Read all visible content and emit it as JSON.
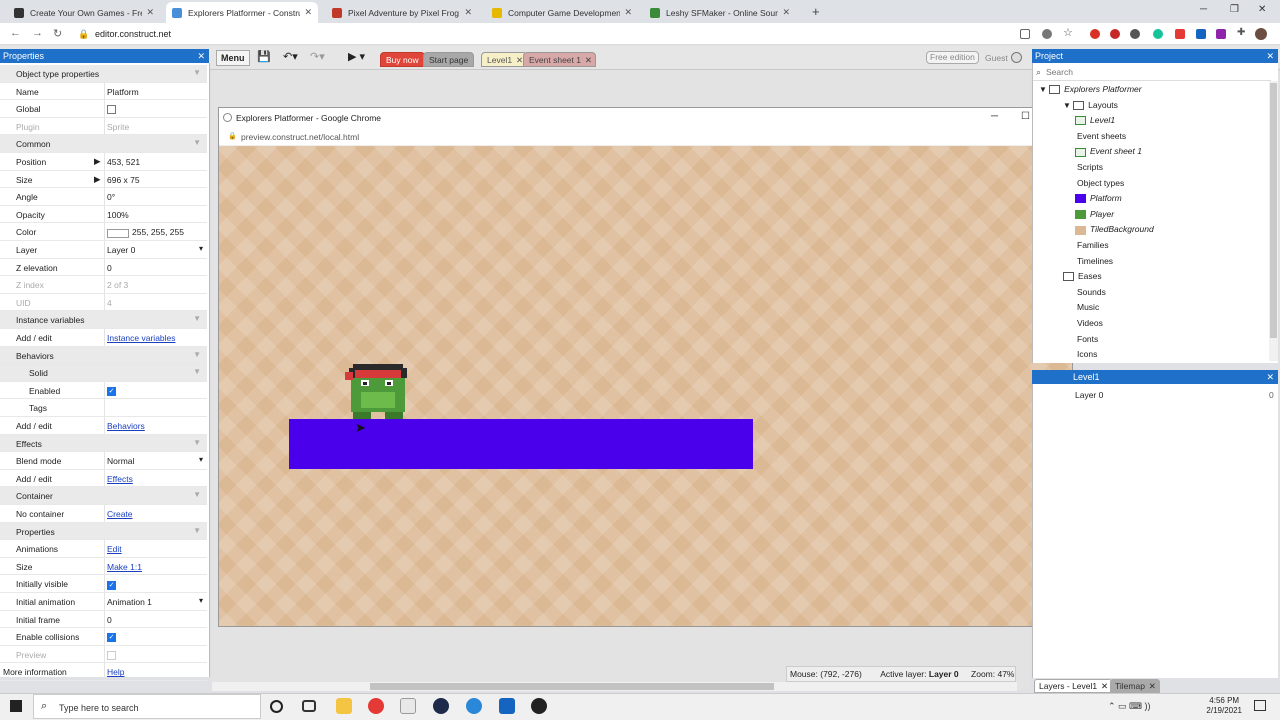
{
  "browser": {
    "tabs": [
      {
        "title": "Create Your Own Games - Free T",
        "color": "#333333"
      },
      {
        "title": "Explorers Platformer - Construct",
        "color": "#4a90d9"
      },
      {
        "title": "Pixel Adventure by Pixel Frog",
        "color": "#c0392b"
      },
      {
        "title": "Computer Game Development W",
        "color": "#e6b800"
      },
      {
        "title": "Leshy SFMaker - Online Sound E",
        "color": "#3a8a3a"
      }
    ],
    "url": "editor.construct.net"
  },
  "editor": {
    "menu_label": "Menu",
    "buy_now": "Buy now",
    "start_page": "Start page",
    "level_tab": "Level1",
    "event_tab": "Event sheet 1",
    "free_edition": "Free edition",
    "guest": "Guest"
  },
  "properties": {
    "title": "Properties",
    "rows": [
      {
        "k": "Object type properties",
        "sec": true
      },
      {
        "k": "Name",
        "v": "Platform"
      },
      {
        "k": "Global",
        "chk": "off"
      },
      {
        "k": "Plugin",
        "v": "Sprite",
        "dim": true
      },
      {
        "k": "Common",
        "sec": true
      },
      {
        "k": "Position",
        "v": "453, 521",
        "expand": true
      },
      {
        "k": "Size",
        "v": "696 x 75",
        "expand": true
      },
      {
        "k": "Angle",
        "v": "0°"
      },
      {
        "k": "Opacity",
        "v": "100%"
      },
      {
        "k": "Color",
        "v": "255, 255, 255",
        "swatch": true
      },
      {
        "k": "Layer",
        "v": "Layer 0",
        "dd": true
      },
      {
        "k": "Z elevation",
        "v": "0"
      },
      {
        "k": "Z index",
        "v": "2 of 3",
        "dim": true
      },
      {
        "k": "UID",
        "v": "4",
        "dim": true
      },
      {
        "k": "Instance variables",
        "sec": true
      },
      {
        "k": "Add / edit",
        "v": "Instance variables",
        "link": true
      },
      {
        "k": "Behaviors",
        "sec": true
      },
      {
        "k": "Solid",
        "sec": true,
        "indent": true
      },
      {
        "k": "Enabled",
        "chk": "on",
        "indent": true
      },
      {
        "k": "Tags",
        "indent": true
      },
      {
        "k": "Add / edit",
        "v": "Behaviors",
        "link": true
      },
      {
        "k": "Effects",
        "sec": true
      },
      {
        "k": "Blend mode",
        "v": "Normal",
        "dd": true
      },
      {
        "k": "Add / edit",
        "v": "Effects",
        "link": true
      },
      {
        "k": "Container",
        "sec": true
      },
      {
        "k": "No container",
        "v": "Create",
        "link": true
      },
      {
        "k": "Properties",
        "sec": true
      },
      {
        "k": "Animations",
        "v": "Edit",
        "link": true
      },
      {
        "k": "Size",
        "v": "Make 1:1",
        "link": true
      },
      {
        "k": "Initially visible",
        "chk": "on"
      },
      {
        "k": "Initial animation",
        "v": "Animation 1",
        "dd": true
      },
      {
        "k": "Initial frame",
        "v": "0"
      },
      {
        "k": "Enable collisions",
        "chk": "on"
      },
      {
        "k": "Preview",
        "chk": "off",
        "dim": true
      },
      {
        "k": "More information",
        "v": "Help",
        "link": true,
        "noindent": true
      }
    ]
  },
  "preview": {
    "title": "Explorers Platformer - Google Chrome",
    "url": "preview.construct.net/local.html",
    "platform_color": "#4a00ea"
  },
  "status": {
    "mouse": "Mouse: (792, -276)",
    "layer_label": "Active layer:",
    "layer_value": "Layer 0",
    "zoom": "Zoom: 47%"
  },
  "project": {
    "title": "Project",
    "search_placeholder": "Search",
    "items": [
      {
        "label": "Explorers Platformer",
        "italic": true
      },
      {
        "label": "Layouts"
      },
      {
        "label": "Level1",
        "italic": true
      },
      {
        "label": "Event sheets"
      },
      {
        "label": "Event sheet 1",
        "italic": true
      },
      {
        "label": "Scripts"
      },
      {
        "label": "Object types"
      },
      {
        "label": "Platform",
        "italic": true
      },
      {
        "label": "Player",
        "italic": true
      },
      {
        "label": "TiledBackground",
        "italic": true
      },
      {
        "label": "Families"
      },
      {
        "label": "Timelines"
      },
      {
        "label": "Eases"
      },
      {
        "label": "Sounds"
      },
      {
        "label": "Music"
      },
      {
        "label": "Videos"
      },
      {
        "label": "Fonts"
      },
      {
        "label": "Icons"
      }
    ]
  },
  "layers": {
    "title": "Level1",
    "row_name": "Layer 0",
    "row_value": "0",
    "tab_layers": "Layers - Level1",
    "tab_tilemap": "Tilemap"
  },
  "taskbar": {
    "search_placeholder": "Type here to search",
    "time": "4:56 PM",
    "date": "2/19/2021"
  }
}
